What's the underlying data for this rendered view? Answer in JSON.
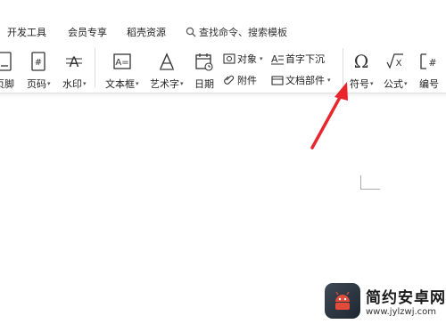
{
  "menu": {
    "items": [
      "开发工具",
      "会员专享",
      "稻壳资源"
    ],
    "search_placeholder": "查找命令、搜索模板"
  },
  "ribbon": {
    "header_footer": "页脚",
    "page_number": "页码",
    "watermark": "水印",
    "textbox": "文本框",
    "wordart": "艺术字",
    "date": "日期",
    "object": "对象",
    "attachment": "附件",
    "drop_cap": "首字下沉",
    "doc_parts": "文档部件",
    "symbol": "符号",
    "formula": "公式",
    "numbering": "编号",
    "caret": "▾"
  },
  "colors": {
    "accent": "#1e6fd0",
    "arrow": "#e8262b",
    "icon": "#333333"
  },
  "watermark_site": {
    "title": "简约安卓网",
    "url": "www.jylzwj.com"
  }
}
